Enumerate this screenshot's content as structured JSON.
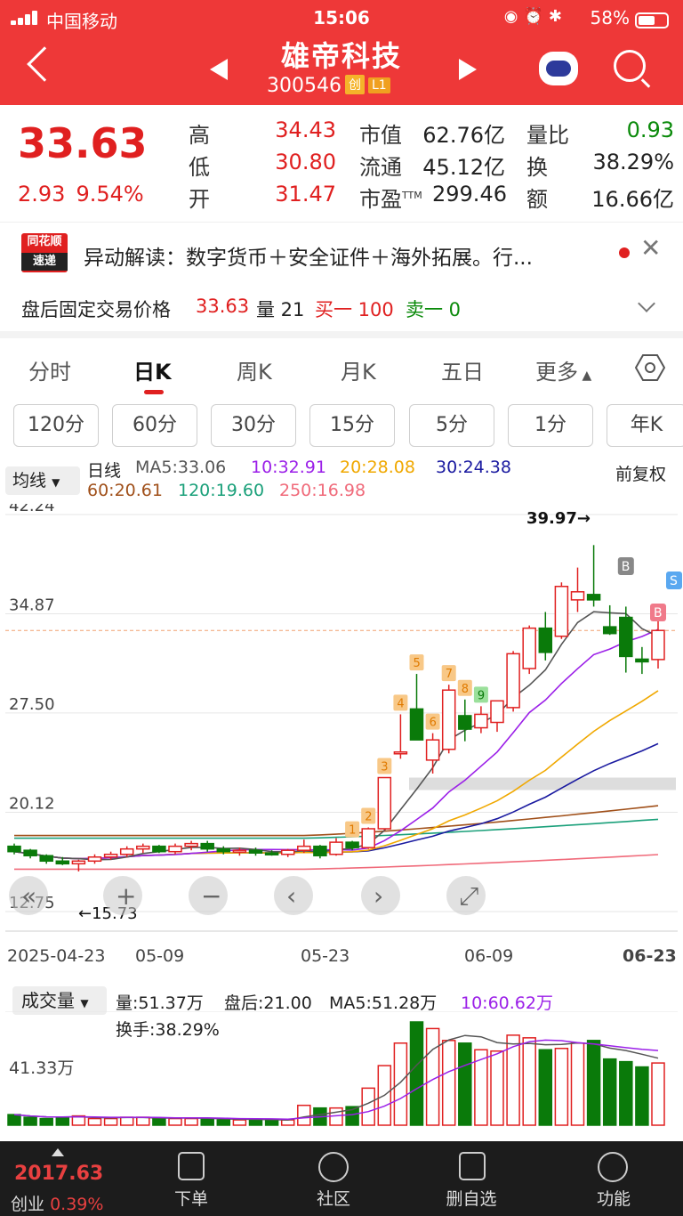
{
  "status": {
    "carrier": "中国移动",
    "time": "15:06",
    "battery": "58%"
  },
  "nav": {
    "title": "雄帝科技",
    "code": "300546",
    "tag1": "创",
    "tag2": "L1"
  },
  "quote": {
    "price": "33.63",
    "change": "2.93",
    "change_pct": "9.54%",
    "rows": [
      {
        "l1": "高",
        "v1": "34.43",
        "l2": "市值",
        "v2": "62.76亿",
        "l3": "量比",
        "v3": "0.93"
      },
      {
        "l1": "低",
        "v1": "30.80",
        "l2": "流通",
        "v2": "45.12亿",
        "l3": "换",
        "v3": "38.29%"
      },
      {
        "l1": "开",
        "v1": "31.47",
        "l2": "市盈",
        "v2": "299.46",
        "l3": "额",
        "v3": "16.66亿"
      }
    ],
    "pe_sup": "TTM"
  },
  "news": {
    "logo1": "同花顺",
    "logo2": "速递",
    "text": "异动解读：数字货币＋安全证件＋海外拓展。行..."
  },
  "after_hours": {
    "label": "盘后固定交易价格",
    "price": "33.63",
    "vol_label": "量 21",
    "buy": "买一 100",
    "sell": "卖一 0"
  },
  "tabs": [
    "分时",
    "日K",
    "周K",
    "月K",
    "五日",
    "更多"
  ],
  "periods": [
    "120分",
    "60分",
    "30分",
    "15分",
    "5分",
    "1分",
    "年K"
  ],
  "ma": {
    "dropdown": "均线",
    "line": "日线",
    "ma5": "MA5:33.06",
    "ma10": "10:32.91",
    "ma20": "20:28.08",
    "ma30": "30:24.38",
    "ma60": "60:20.61",
    "ma120": "120:19.60",
    "ma250": "250:16.98",
    "adjust": "前复权"
  },
  "colors": {
    "up": "#e02020",
    "down": "#0a7a0a",
    "ma5": "#555555",
    "ma10": "#9b1fe8",
    "ma20": "#f0a800",
    "ma30": "#1a1aa0",
    "ma60": "#a0501a",
    "ma120": "#1aa07a",
    "ma250": "#f06a7a"
  },
  "chart_data": {
    "type": "candlestick",
    "y_ticks": [
      "42.24",
      "34.87",
      "27.50",
      "20.12",
      "12.75"
    ],
    "x_ticks": [
      "2025-04-23",
      "05-09",
      "05-23",
      "06-09",
      "06-23"
    ],
    "annotations": {
      "high": "39.97→",
      "low": "←15.73",
      "signals": [
        "1",
        "2",
        "3",
        "4",
        "5",
        "6",
        "7",
        "8",
        "9"
      ],
      "bs": [
        "B",
        "B",
        "S"
      ]
    },
    "candles": [
      [
        17.6,
        17.8,
        17.0,
        17.2
      ],
      [
        17.3,
        17.4,
        16.7,
        16.9
      ],
      [
        16.9,
        17.0,
        16.3,
        16.5
      ],
      [
        16.5,
        16.8,
        16.2,
        16.3
      ],
      [
        16.3,
        16.6,
        15.73,
        16.5
      ],
      [
        16.5,
        17.0,
        16.3,
        16.8
      ],
      [
        16.8,
        17.2,
        16.6,
        17.0
      ],
      [
        17.0,
        17.6,
        16.8,
        17.4
      ],
      [
        17.4,
        17.8,
        17.1,
        17.6
      ],
      [
        17.6,
        17.7,
        17.1,
        17.2
      ],
      [
        17.2,
        17.8,
        17.0,
        17.6
      ],
      [
        17.6,
        18.0,
        17.3,
        17.8
      ],
      [
        17.8,
        18.0,
        17.2,
        17.4
      ],
      [
        17.4,
        17.6,
        17.0,
        17.2
      ],
      [
        17.2,
        17.5,
        16.9,
        17.3
      ],
      [
        17.3,
        17.5,
        16.9,
        17.1
      ],
      [
        17.1,
        17.3,
        16.9,
        17.0
      ],
      [
        17.0,
        17.4,
        16.8,
        17.3
      ],
      [
        17.3,
        18.1,
        17.1,
        17.6
      ],
      [
        17.6,
        17.7,
        16.7,
        16.9
      ],
      [
        17.0,
        18.2,
        16.9,
        17.9
      ],
      [
        17.9,
        18.0,
        17.3,
        17.5
      ],
      [
        17.5,
        19.0,
        17.4,
        18.9
      ],
      [
        18.9,
        22.7,
        18.8,
        22.7
      ],
      [
        24.5,
        27.4,
        24.1,
        24.6
      ],
      [
        27.8,
        30.4,
        25.6,
        25.5
      ],
      [
        24.0,
        26.0,
        23.0,
        25.5
      ],
      [
        24.8,
        29.6,
        24.5,
        29.2
      ],
      [
        27.3,
        28.5,
        25.4,
        26.3
      ],
      [
        26.4,
        28.0,
        26.0,
        27.4
      ],
      [
        26.8,
        28.4,
        26.1,
        28.4
      ],
      [
        27.9,
        32.1,
        27.6,
        31.9
      ],
      [
        30.8,
        34.0,
        30.4,
        33.8
      ],
      [
        33.8,
        35.0,
        31.4,
        32.0
      ],
      [
        33.2,
        37.2,
        33.0,
        36.9
      ],
      [
        35.9,
        38.3,
        35.0,
        36.5
      ],
      [
        36.3,
        39.97,
        35.4,
        35.9
      ],
      [
        33.9,
        35.5,
        33.3,
        33.4
      ],
      [
        34.6,
        35.4,
        30.5,
        31.7
      ],
      [
        31.5,
        32.4,
        30.4,
        31.3
      ],
      [
        31.47,
        34.43,
        30.8,
        33.63
      ]
    ],
    "volume": {
      "label": "成交量",
      "vol": "量:51.37万",
      "after": "盘后:21.00",
      "ma5": "MA5:51.28万",
      "ma10": "10:60.62万",
      "turnover": "换手:38.29%",
      "scale": "41.33万"
    },
    "volumes": [
      8,
      6,
      5,
      6,
      7,
      5,
      5,
      6,
      6,
      5,
      5,
      5,
      5,
      4,
      4,
      4,
      4,
      4,
      15,
      13,
      13,
      14,
      28,
      45,
      62,
      78,
      73,
      64,
      62,
      57,
      56,
      68,
      66,
      57,
      58,
      62,
      64,
      50,
      48,
      44,
      47
    ]
  },
  "bottom": {
    "index_val": "2017.63",
    "index_name": "创业",
    "index_pct": "0.39%",
    "items": [
      "下单",
      "社区",
      "删自选",
      "功能"
    ]
  }
}
